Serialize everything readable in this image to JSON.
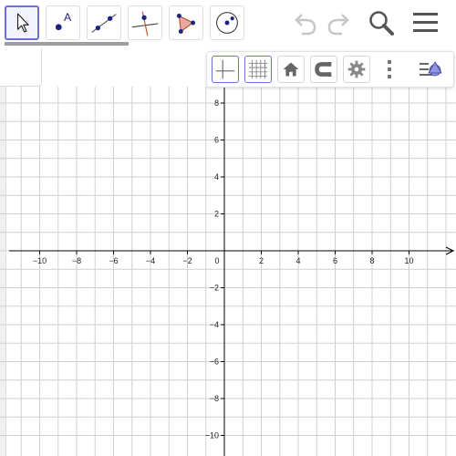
{
  "toolbar": {
    "tools": [
      {
        "name": "move-tool",
        "selected": true
      },
      {
        "name": "point-tool",
        "label": "A"
      },
      {
        "name": "line-tool"
      },
      {
        "name": "perpendicular-line-tool"
      },
      {
        "name": "polygon-tool"
      },
      {
        "name": "circle-tool"
      }
    ],
    "actions": [
      "undo-icon",
      "redo-icon",
      "search-icon",
      "menu-icon"
    ]
  },
  "graphics_toolbar": {
    "buttons": [
      {
        "name": "toggle-axes-button",
        "icon": "axes-icon",
        "active": true
      },
      {
        "name": "toggle-grid-button",
        "icon": "grid-icon",
        "active": true
      },
      {
        "name": "standard-view-button",
        "icon": "home-icon"
      },
      {
        "name": "point-capturing-button",
        "icon": "magnet-icon"
      },
      {
        "name": "graphics-settings-button",
        "icon": "gear-icon"
      },
      {
        "name": "more-options-button",
        "icon": "kebab-icon"
      },
      {
        "name": "style-bar-toggle-button",
        "icon": "style-bar-icon"
      }
    ]
  },
  "graph": {
    "x_ticks": [
      "−10",
      "−8",
      "−6",
      "−4",
      "−2",
      "0",
      "2",
      "4",
      "6",
      "8",
      "10"
    ],
    "y_ticks_positive": [
      "8",
      "6",
      "4",
      "2"
    ],
    "y_ticks_negative": [
      "−2",
      "−4",
      "−6",
      "−8",
      "−10"
    ],
    "x_range": [
      -11.6,
      12.5
    ],
    "y_range": [
      -10.9,
      8.7
    ],
    "grid": true,
    "axes": true
  },
  "colors": {
    "accent": "#6b6fd6",
    "point": "#1a237e",
    "grid": "#d0d0d0",
    "axis": "#000000"
  }
}
